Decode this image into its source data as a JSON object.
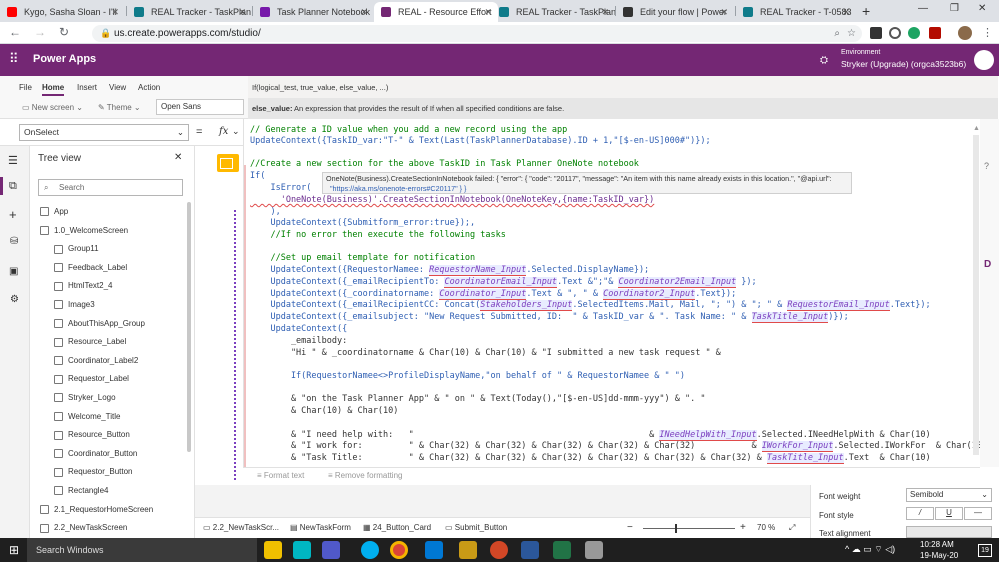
{
  "browser": {
    "tabs": [
      {
        "label": "Kygo, Sasha Sloan - I'll",
        "color": "#ff0000"
      },
      {
        "label": "REAL Tracker - TaskPlan",
        "color": "#0f7b8a"
      },
      {
        "label": "Task Planner Notebook",
        "color": "#7719aa"
      },
      {
        "label": "REAL - Resource Effort",
        "color": "#742774"
      },
      {
        "label": "REAL Tracker - TaskPlan",
        "color": "#0f7b8a"
      },
      {
        "label": "Edit your flow | Power",
        "color": "#333333"
      },
      {
        "label": "REAL Tracker - T-0583",
        "color": "#0f7b8a"
      }
    ],
    "url": "us.create.powerapps.com/studio/"
  },
  "app": {
    "title": "Power Apps",
    "environment_label": "Environment",
    "environment_name": "Stryker (Upgrade) (orgca3523b6)"
  },
  "ribbon": {
    "menu": [
      "File",
      "Home",
      "Insert",
      "View",
      "Action"
    ],
    "new_screen": "New screen",
    "theme": "Theme",
    "font": "Open Sans"
  },
  "tooltip": {
    "signature": "If(logical_test, true_value, else_value, ...)",
    "param_name": "else_value:",
    "param_desc": "An expression that provides the result of If when all specified conditions are false."
  },
  "formula": {
    "property": "OnSelect",
    "equals": "=",
    "fx": "fx"
  },
  "treeview": {
    "title": "Tree view",
    "search_placeholder": "Search",
    "items": [
      {
        "label": "App",
        "indent": 0
      },
      {
        "label": "1.0_WelcomeScreen",
        "indent": 0
      },
      {
        "label": "Group11",
        "indent": 1
      },
      {
        "label": "Feedback_Label",
        "indent": 1
      },
      {
        "label": "HtmlText2_4",
        "indent": 1
      },
      {
        "label": "Image3",
        "indent": 1
      },
      {
        "label": "AboutThisApp_Group",
        "indent": 1
      },
      {
        "label": "Resource_Label",
        "indent": 1
      },
      {
        "label": "Coordinator_Label2",
        "indent": 1
      },
      {
        "label": "Requestor_Label",
        "indent": 1
      },
      {
        "label": "Stryker_Logo",
        "indent": 1
      },
      {
        "label": "Welcome_Title",
        "indent": 1
      },
      {
        "label": "Resource_Button",
        "indent": 1
      },
      {
        "label": "Coordinator_Button",
        "indent": 1
      },
      {
        "label": "Requestor_Button",
        "indent": 1
      },
      {
        "label": "Rectangle4",
        "indent": 1
      },
      {
        "label": "2.1_RequestorHomeScreen",
        "indent": 0
      },
      {
        "label": "2.2_NewTaskScreen",
        "indent": 0
      }
    ]
  },
  "error_popup": {
    "line1": "OneNote(Business).CreateSectionInNotebook failed: { \"error\": { \"code\": \"20117\", \"message\": \"An item with this name already exists in this location.\", \"@api.url\":",
    "line2": "\"https://aka.ms/onenote-errors#C20117\" } }"
  },
  "code": {
    "l01": "// Generate a ID value when you add a new record using the app",
    "l02": "UpdateContext({TaskID_var:\"T-\" & Text(Last(TaskPlannerDatabase).ID + 1,\"[$-en-US]000#\")});",
    "l03": "//Create a new section for the above TaskID in Task Planner OneNote notebook",
    "l04": "If(",
    "l05": "    IsError(",
    "l06": "      'OneNote(Business)'.CreateSectionInNotebook(OneNoteKey,{name:TaskID_var})",
    "l07": "    ),",
    "l08": "    UpdateContext({Submitform_error:true});,",
    "l09": "    //If no error then execute the following tasks",
    "l10": "    //Set up email template for notification",
    "l11a": "    UpdateContext({RequestorNamee: ",
    "l11b": "RequestorName_Input",
    "l11c": ".Selected.DisplayName});",
    "l12a": "    UpdateContext({_emailRecipientTo: ",
    "l12b": "CoordinatorEmail_Input",
    "l12c": ".Text &\";\"& ",
    "l12d": "Coordinator2Email_Input",
    "l12e": " });",
    "l13a": "    UpdateContext({_coordinatorname: ",
    "l13b": "Coordinator_Input",
    "l13c": ".Text & \", \" & ",
    "l13d": "Coordinator2_Input",
    "l13e": ".Text});",
    "l14a": "    UpdateContext({_emailRecipientCC: Concat(",
    "l14b": "Stakeholders_Input",
    "l14c": ".SelectedItems.Mail, Mail, \"; \") & \"; \" & ",
    "l14d": "RequestorEmail_Input",
    "l14e": ".Text});",
    "l15a": "    UpdateContext({_emailsubject: \"New Request Submitted, ID:  \" & TaskID_var & \". Task Name: \" & ",
    "l15b": "TaskTitle_Input",
    "l15c": ")});",
    "l16": "    UpdateContext({",
    "l17": "        _emailbody:",
    "l18": "        \"Hi \" & _coordinatorname & Char(10) & Char(10) & \"I submitted a new task request \" &",
    "l19": "        If(RequestorNamee<>ProfileDisplayName,\"on behalf of \" & RequestorNamee & \" \")",
    "l20": "        & \"on the Task Planner App\" & \" on \" & Text(Today(),\"[$-en-US]dd-mmm-yyy\") & \". \"",
    "l21": "        & Char(10) & Char(10)",
    "l22a": "        & \"I need help with:   \"                                              & ",
    "l22b": "INeedHelpWith_Input",
    "l22c": ".Selected.INeedHelpWith & Char(10)",
    "l23a": "        & \"I work for:         \" & Char(32) & Char(32) & Char(32) & Char(32) & Char(32)           & ",
    "l23b": "IWorkFor_Input",
    "l23c": ".Selected.IWorkFor  & Char(10)",
    "l24a": "        & \"Task Title:         \" & Char(32) & Char(32) & Char(32) & Char(32) & Char(32) & Char(32) & ",
    "l24b": "TaskTitle_Input",
    "l24c": ".Text  & Char(10)"
  },
  "format_bar": {
    "format_text": "Format text",
    "remove_formatting": "Remove formatting"
  },
  "bottom_tabs": [
    "2.2_NewTaskScr...",
    "NewTaskForm",
    "24_Button_Card",
    "Submit_Button"
  ],
  "zoom": {
    "minus": "−",
    "plus": "+",
    "value": "70",
    "unit": "%"
  },
  "properties": {
    "font_weight_label": "Font weight",
    "font_weight_value": "Semibold",
    "font_style_label": "Font style",
    "text_alignment_label": "Text alignment"
  },
  "taskbar": {
    "search": "Search Windows",
    "time": "10:28 AM",
    "date": "19-May-20",
    "notif_count": "19"
  },
  "colors": {
    "powerapps_purple": "#742774",
    "taskbar": "#1f1f1f"
  }
}
